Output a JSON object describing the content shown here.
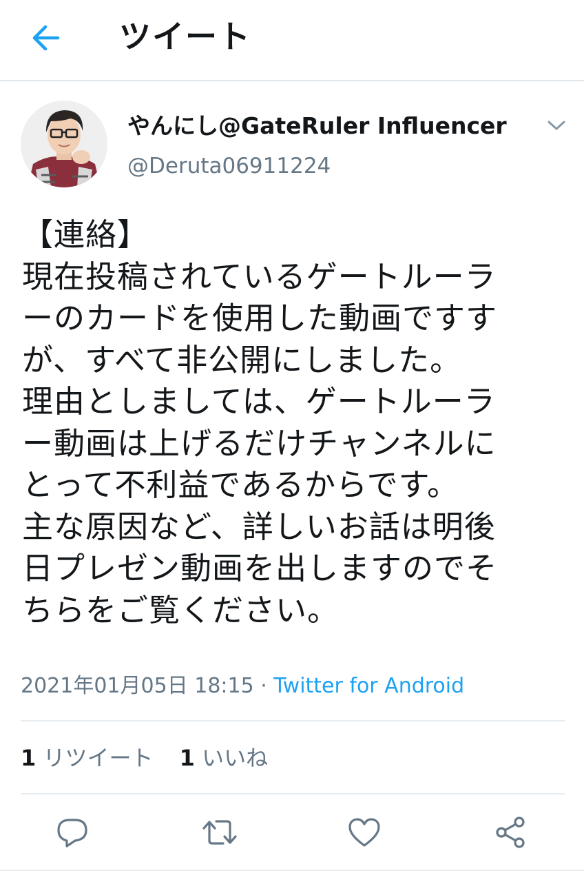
{
  "header": {
    "title": "ツイート",
    "back_icon": "arrow-left-icon",
    "accent_color": "#1da1f2"
  },
  "tweet": {
    "author_name": "やんにし@GateRuler Influencer",
    "author_handle": "@Deruta06911224",
    "avatar_icon": "profile-photo",
    "menu_icon": "chevron-down-icon",
    "body_lines": [
      " 【連絡】",
      "現在投稿されているゲートルーラ",
      "ーのカードを使用した動画ですす",
      "が、すべて非公開にしました。",
      "理由としましては、ゲートルーラ",
      "ー動画は上げるだけチャンネルに",
      "とって不利益であるからです。",
      "主な原因など、詳しいお話は明後",
      "日プレゼン動画を出しますのでそ",
      "ちらをご覧ください。"
    ],
    "timestamp": "2021年01月05日 18:15",
    "meta_separator": " · ",
    "client": "Twitter for Android",
    "retweet_count": "1",
    "retweet_label": "リツイート",
    "like_count": "1",
    "like_label": "いいね"
  },
  "actions": {
    "reply_icon": "reply-icon",
    "retweet_icon": "retweet-icon",
    "like_icon": "heart-icon",
    "share_icon": "share-icon",
    "icon_color": "#657786"
  }
}
